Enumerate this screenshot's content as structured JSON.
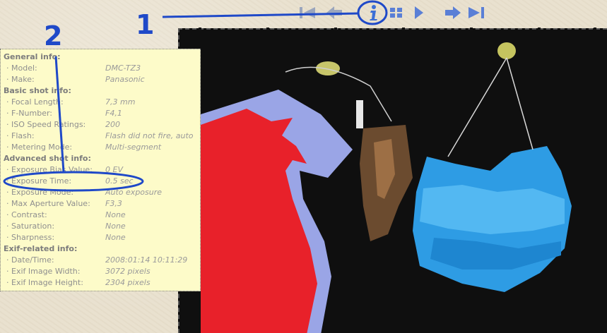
{
  "callouts": {
    "one": "1",
    "two": "2"
  },
  "toolbar": {
    "icons": [
      "first-image-icon",
      "previous-image-icon",
      "info-icon",
      "thumbnails-icon",
      "play-icon",
      "next-image-icon",
      "last-image-icon"
    ]
  },
  "info": {
    "sections": [
      {
        "title": "General info:",
        "rows": [
          {
            "label": "· Model:",
            "value": "DMC-TZ3"
          },
          {
            "label": "· Make:",
            "value": "Panasonic"
          }
        ]
      },
      {
        "title": "Basic shot info:",
        "rows": [
          {
            "label": "· Focal Length:",
            "value": "7,3 mm"
          },
          {
            "label": "· F-Number:",
            "value": "F4,1"
          },
          {
            "label": "· ISO Speed Ratings:",
            "value": "200"
          },
          {
            "label": "· Flash:",
            "value": "Flash did not fire, auto"
          },
          {
            "label": "· Metering Mode:",
            "value": "Multi-segment"
          }
        ]
      },
      {
        "title": "Advanced shot info:",
        "rows": [
          {
            "label": "· Exposure Bias Value:",
            "value": "0 EV"
          },
          {
            "label": "· Exposure Time:",
            "value": "0.5 sec"
          },
          {
            "label": "· Exposure Mode:",
            "value": "Auto exposure"
          },
          {
            "label": "· Max Aperture Value:",
            "value": "F3,3"
          },
          {
            "label": "· Contrast:",
            "value": "None"
          },
          {
            "label": "· Saturation:",
            "value": "None"
          },
          {
            "label": "· Sharpness:",
            "value": "None"
          }
        ]
      },
      {
        "title": "Exif-related info:",
        "rows": [
          {
            "label": "· Date/Time:",
            "value": "2008:01:14 10:11:29"
          },
          {
            "label": "· Exif Image Width:",
            "value": "3072 pixels"
          },
          {
            "label": "· Exif Image Height:",
            "value": "2304 pixels"
          }
        ]
      }
    ]
  },
  "colors": {
    "annotation": "#1f49c8",
    "panel": "#fdfbc9",
    "toolbar": "#5a7fd6"
  }
}
